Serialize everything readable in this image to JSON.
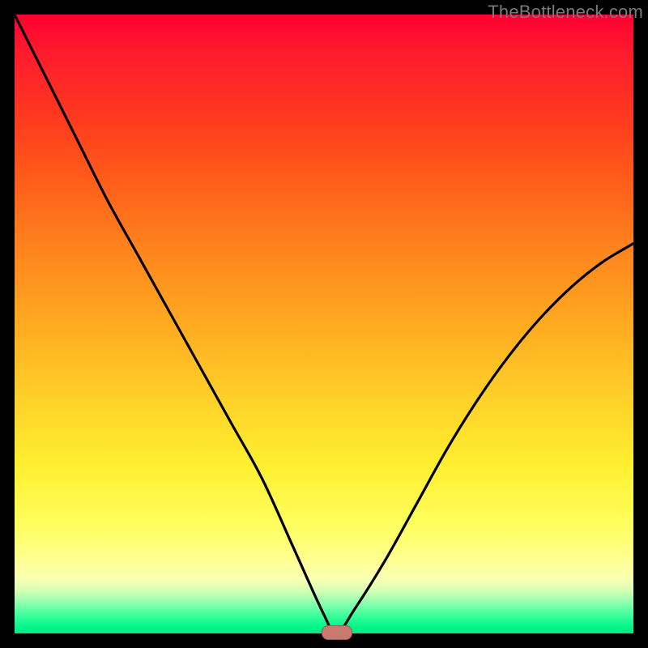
{
  "watermark": "TheBottleneck.com",
  "colors": {
    "frame": "#000000",
    "gradient_top": "#ff0030",
    "gradient_mid": "#ffff62",
    "gradient_bottom": "#00e884",
    "curve": "#000000",
    "marker_fill": "#c97a70",
    "marker_border": "#9c5a52"
  },
  "chart_data": {
    "type": "line",
    "title": "",
    "xlabel": "",
    "ylabel": "",
    "xlim": [
      0,
      100
    ],
    "ylim": [
      0,
      100
    ],
    "note": "Axes unlabeled; values are percentages of plot extent (0=left/bottom, 100=right/top). Curve is a V with minimum near x≈52, y≈0.",
    "series": [
      {
        "name": "curve",
        "x": [
          0,
          5,
          10,
          15,
          20,
          25,
          30,
          35,
          40,
          45,
          50,
          52,
          55,
          60,
          65,
          70,
          75,
          80,
          85,
          90,
          95,
          100
        ],
        "values": [
          100,
          90,
          80,
          70,
          61,
          52,
          43,
          34,
          25,
          14,
          3,
          0,
          4,
          12,
          21,
          30,
          38,
          45,
          51,
          56,
          60,
          63
        ]
      }
    ],
    "marker": {
      "x": 52,
      "y": 0,
      "shape": "rounded-rect"
    }
  }
}
